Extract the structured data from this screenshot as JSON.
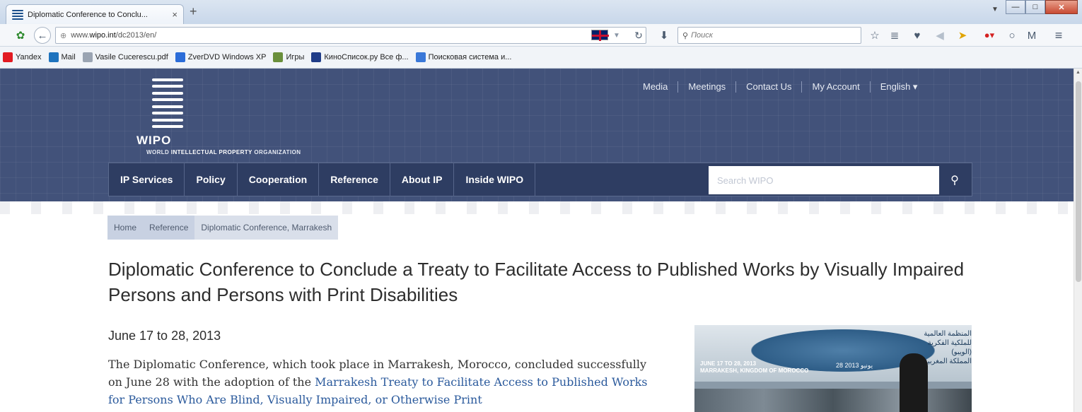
{
  "browser": {
    "tab_title": "Diplomatic Conference to Conclu...",
    "tab_close": "×",
    "new_tab": "+",
    "url_prefix": "www.",
    "url_domain": "wipo.int",
    "url_path": "/dc2013/en/",
    "search_placeholder": "Поиск",
    "bookmarks": [
      {
        "label": "Yandex",
        "icon": "yandex-icon",
        "color": "#e21b22"
      },
      {
        "label": "Mail",
        "icon": "mail-icon",
        "color": "#1e73be"
      },
      {
        "label": "Vasile Cucerescu.pdf",
        "icon": "document-icon",
        "color": "#9aa4b2"
      },
      {
        "label": "ZverDVD Windows XP",
        "icon": "zverdvd-icon",
        "color": "#2b6cd8"
      },
      {
        "label": "Игры",
        "icon": "games-icon",
        "color": "#6a8f3c"
      },
      {
        "label": "КиноСписок.ру Все ф...",
        "icon": "film-icon",
        "color": "#1f3c88"
      },
      {
        "label": "Поисковая система и...",
        "icon": "search-engine-icon",
        "color": "#3a78d8"
      }
    ]
  },
  "site": {
    "logo_text": "WIPO",
    "org_name_pre": "WORLD ",
    "org_name_bold": "INTELLECTUAL PROPERTY",
    "org_name_post": " ORGANIZATION",
    "top_links": [
      "Media",
      "Meetings",
      "Contact Us",
      "My Account",
      "English ▾"
    ],
    "main_nav": [
      "IP Services",
      "Policy",
      "Cooperation",
      "Reference",
      "About IP",
      "Inside WIPO"
    ],
    "search_placeholder": "Search WIPO",
    "breadcrumb": [
      "Home",
      "Reference",
      "Diplomatic Conference, Marrakesh"
    ]
  },
  "content": {
    "title": "Diplomatic Conference to Conclude a Treaty to Facilitate Access to Published Works by Visually Impaired Persons and Persons with Print Disabilities",
    "date": "June 17 to 28, 2013",
    "para_text_1": "The Diplomatic Conference, which took place in Marrakesh, Morocco, concluded successfully on June 28 with the adoption of the ",
    "para_link": "Marrakesh Treaty to Facilitate Access to Published Works for Persons Who Are Blind, Visually Impaired, or Otherwise Print",
    "photo_caption_1": "JUNE 17 TO 28, 2013",
    "photo_caption_2": "MARRAKESH, KINGDOM OF MOROCCO",
    "photo_caption_ar": "28 يونيو 2013",
    "photo_ar_1": "المنظمة العالمية للملكية الفكرية (الويبو)",
    "photo_ar_2": "المملكة المغربية"
  },
  "colors": {
    "header": "#42527a",
    "nav": "#2e3d62",
    "link": "#2b5a9c"
  }
}
